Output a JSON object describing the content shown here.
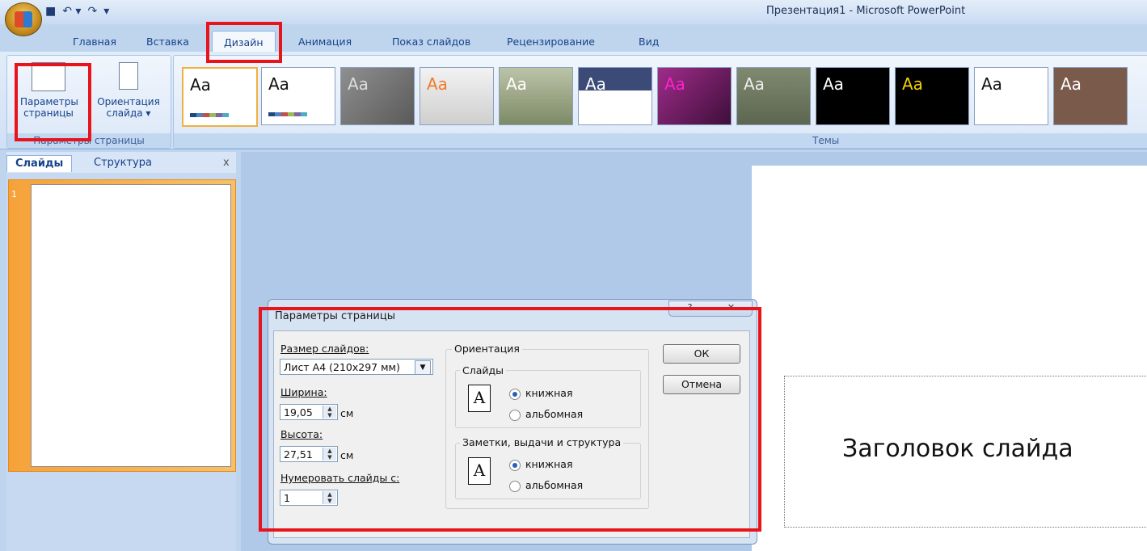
{
  "window": {
    "title": "Презентация1 - Microsoft PowerPoint"
  },
  "tabs": [
    {
      "label": "Главная"
    },
    {
      "label": "Вставка"
    },
    {
      "label": "Дизайн",
      "active": true
    },
    {
      "label": "Анимация"
    },
    {
      "label": "Показ слайдов"
    },
    {
      "label": "Рецензирование"
    },
    {
      "label": "Вид"
    }
  ],
  "ribbon": {
    "page_setup_group": {
      "page_setup_btn": "Параметры страницы",
      "orientation_btn": "Ориентация слайда ▾",
      "label": "Параметры страницы"
    },
    "themes_group": {
      "label": "Темы",
      "theme_glyph": "Aa"
    }
  },
  "left_pane": {
    "tab_slides": "Слайды",
    "tab_outline": "Структура",
    "close": "x",
    "slide_number": "1"
  },
  "slide": {
    "title_placeholder": "Заголовок слайда"
  },
  "dialog": {
    "title": "Параметры страницы",
    "help_btn": "?",
    "close_btn": "✕",
    "size_label": "Размер слайдов:",
    "size_value": "Лист A4 (210x297 мм)",
    "width_label": "Ширина:",
    "width_value": "19,05",
    "width_unit": "см",
    "height_label": "Высота:",
    "height_value": "27,51",
    "height_unit": "см",
    "numbering_label": "Нумеровать слайды с:",
    "numbering_value": "1",
    "orientation_legend": "Ориентация",
    "slides_legend": "Слайды",
    "notes_legend": "Заметки, выдачи и структура",
    "portrait": "книжная",
    "landscape": "альбомная",
    "page_glyph": "A",
    "ok": "ОК",
    "cancel": "Отмена"
  },
  "colors": {
    "highlight": "#e8141b",
    "accent": "#15428b"
  }
}
